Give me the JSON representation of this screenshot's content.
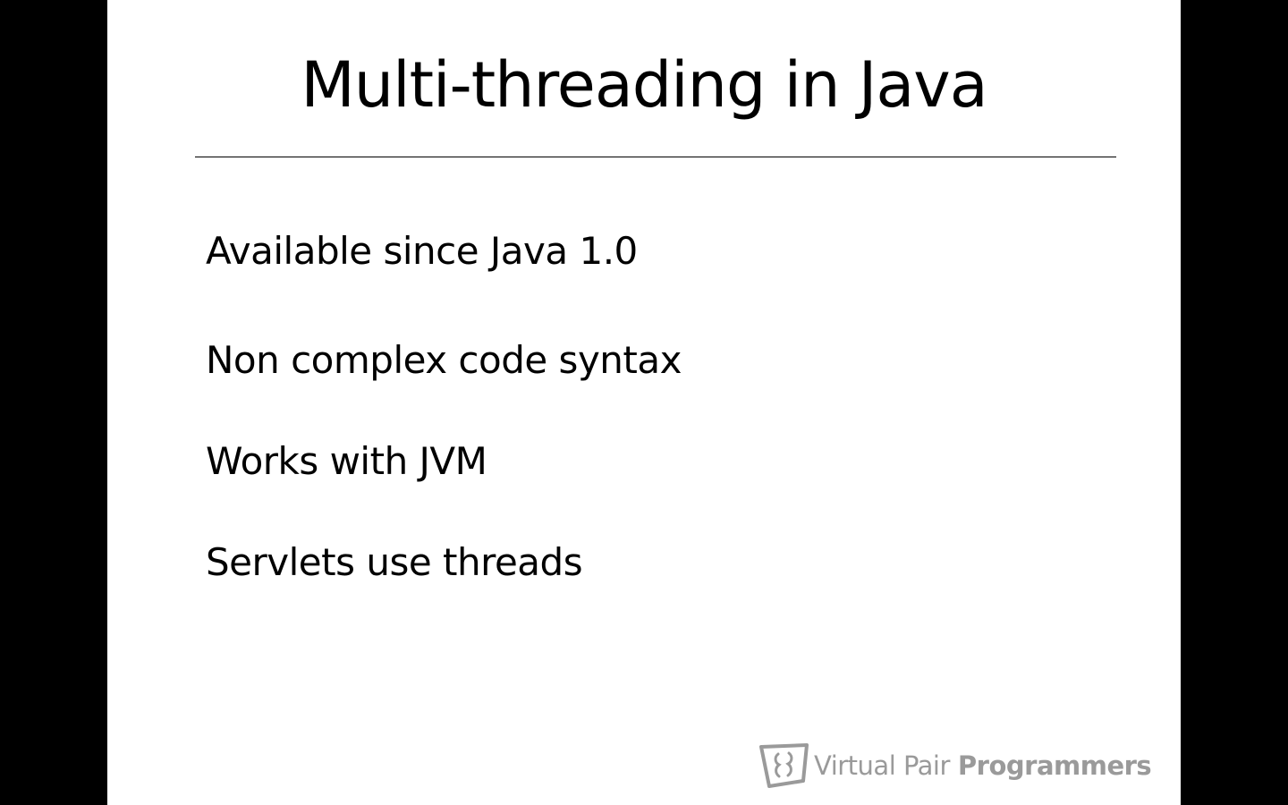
{
  "slide": {
    "title": "Multi-threading in Java",
    "bullets": [
      "Available since Java 1.0",
      "Non complex code syntax",
      "Works with JVM",
      "Servlets use threads"
    ]
  },
  "brand": {
    "name_light": "Virtual Pair",
    "name_bold": "Programmers",
    "logo_icon": "vpp-logo-icon",
    "color": "#9a9a9a"
  },
  "colors": {
    "letterbox": "#000000",
    "slide_background": "#ffffff",
    "text": "#000000"
  }
}
